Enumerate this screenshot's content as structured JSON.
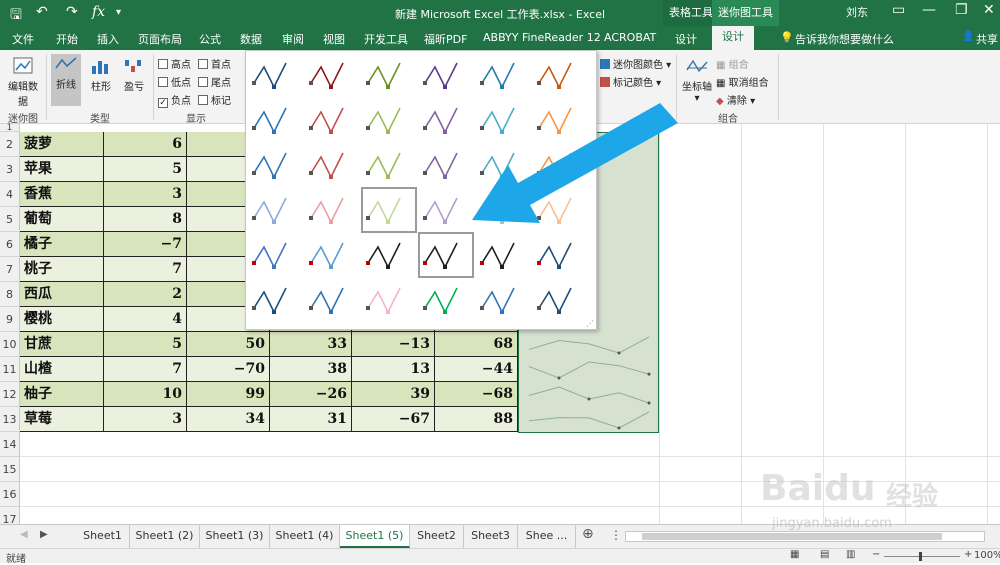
{
  "window": {
    "title": "新建 Microsoft Excel 工作表.xlsx  -  Excel",
    "context_tab_1": "表格工具",
    "context_tab_2": "迷你图工具",
    "user": "刘东",
    "minimize": "—",
    "restore": "❐",
    "close": "✕"
  },
  "tabs": [
    "文件",
    "开始",
    "插入",
    "页面布局",
    "公式",
    "数据",
    "审阅",
    "视图",
    "开发工具",
    "福昕PDF",
    "ABBYY FineReader 12",
    "ACROBAT",
    "设计",
    "设计"
  ],
  "tell_me": "告诉我你想要做什么",
  "share": "共享",
  "ribbon": {
    "edit_data": "编辑数据",
    "group_sparkline": "迷你图",
    "line": "折线",
    "column": "柱形",
    "winloss": "盈亏",
    "group_type": "类型",
    "checks": [
      {
        "label": "高点",
        "checked": false
      },
      {
        "label": "低点",
        "checked": false
      },
      {
        "label": "负点",
        "checked": true
      },
      {
        "label": "首点",
        "checked": false
      },
      {
        "label": "尾点",
        "checked": false
      },
      {
        "label": "标记",
        "checked": false
      }
    ],
    "group_show": "显示",
    "sparkline_color": "迷你图颜色",
    "marker_color": "标记颜色",
    "axis": "坐标轴",
    "group_btn": "组合",
    "ungroup": "取消组合",
    "clear": "清除",
    "group_combine": "组合"
  },
  "rows": [
    {
      "n": "2",
      "name": "菠萝",
      "a": "6",
      "b": "",
      "c": "",
      "d": "",
      "e": ""
    },
    {
      "n": "3",
      "name": "苹果",
      "a": "5",
      "b": "",
      "c": "",
      "d": "",
      "e": ""
    },
    {
      "n": "4",
      "name": "香蕉",
      "a": "3",
      "b": "",
      "c": "",
      "d": "",
      "e": ""
    },
    {
      "n": "5",
      "name": "葡萄",
      "a": "8",
      "b": "",
      "c": "",
      "d": "",
      "e": ""
    },
    {
      "n": "6",
      "name": "橘子",
      "a": "−7",
      "b": "",
      "c": "",
      "d": "",
      "e": ""
    },
    {
      "n": "7",
      "name": "桃子",
      "a": "7",
      "b": "",
      "c": "",
      "d": "",
      "e": ""
    },
    {
      "n": "8",
      "name": "西瓜",
      "a": "2",
      "b": "",
      "c": "",
      "d": "",
      "e": ""
    },
    {
      "n": "9",
      "name": "樱桃",
      "a": "4",
      "b": "",
      "c": "",
      "d": "",
      "e": ""
    },
    {
      "n": "10",
      "name": "甘蔗",
      "a": "5",
      "b": "50",
      "c": "33",
      "d": "−13",
      "e": "68"
    },
    {
      "n": "11",
      "name": "山楂",
      "a": "7",
      "b": "−70",
      "c": "38",
      "d": "13",
      "e": "−44"
    },
    {
      "n": "12",
      "name": "柚子",
      "a": "10",
      "b": "99",
      "c": "−26",
      "d": "39",
      "e": "−68"
    },
    {
      "n": "13",
      "name": "草莓",
      "a": "3",
      "b": "34",
      "c": "31",
      "d": "−67",
      "e": "88"
    }
  ],
  "empty_rows": [
    "14",
    "15",
    "16",
    "17"
  ],
  "first_row": "1",
  "styles": [
    [
      "#1f4e79",
      "#8b1a1a",
      "#6b8e23",
      "#5b3a8c",
      "#1e7fa8",
      "#c55a11"
    ],
    [
      "#2e75b6",
      "#c0504d",
      "#9bbb59",
      "#8064a2",
      "#4bacc6",
      "#f79646"
    ],
    [
      "#2e75b6",
      "#c0504d",
      "#9bbb59",
      "#8064a2",
      "#4bacc6",
      "#f79646"
    ],
    [
      "#8ea9db",
      "#e6a1a0",
      "#c4d79b",
      "#b1a0c7",
      "#92cddc",
      "#fabf8f"
    ],
    [
      "#4472c4",
      "#5b9bd5",
      "#202020",
      "#202020",
      "#202020",
      "#1f4e79"
    ],
    [
      "#1f4e79",
      "#2e75b6",
      "#f4b6c2",
      "#00b050",
      "#2e75b6",
      "#1f4e79"
    ]
  ],
  "selected_styles": [
    "r3c2",
    "r4c3"
  ],
  "sheets": [
    "Sheet1",
    "Sheet1 (2)",
    "Sheet1 (3)",
    "Sheet1 (4)",
    "Sheet1 (5)",
    "Sheet2",
    "Sheet3",
    "Shee ..."
  ],
  "active_sheet": "Sheet1 (5)",
  "status": "就绪",
  "zoom": "100%",
  "watermark": {
    "brand": "Baidu",
    "cn": "经验",
    "url": "jingyan.baidu.com"
  },
  "colors": {
    "excel_green": "#217346",
    "arrow": "#1ea7e8",
    "table_green": "#d8e4bc"
  }
}
